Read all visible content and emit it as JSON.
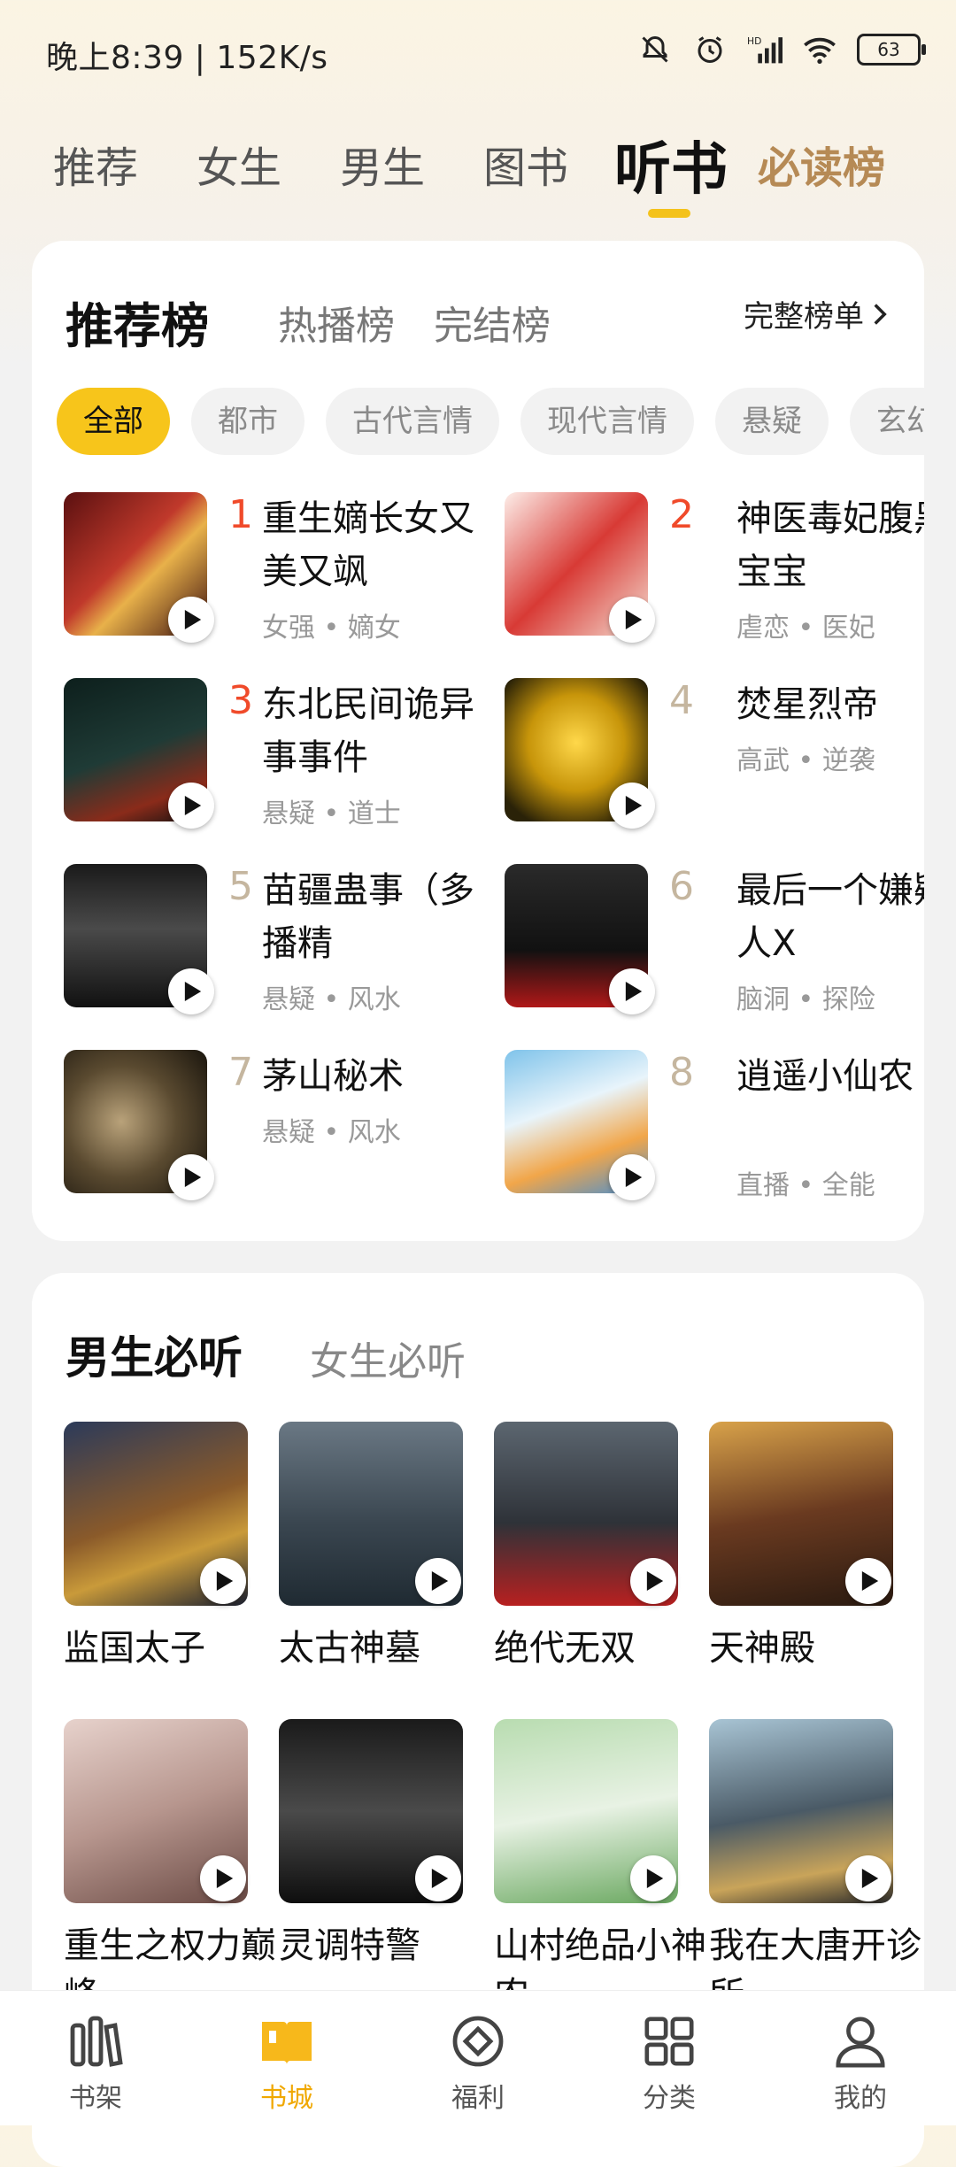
{
  "status_bar": {
    "time": "晚上8:39 | 152K/s",
    "battery": "63"
  },
  "top_tabs": [
    {
      "label": "推荐"
    },
    {
      "label": "女生"
    },
    {
      "label": "男生"
    },
    {
      "label": "图书"
    },
    {
      "label": "听书"
    },
    {
      "label": "必读榜"
    }
  ],
  "rank_card": {
    "tabs": [
      {
        "label": "推荐榜"
      },
      {
        "label": "热播榜"
      },
      {
        "label": "完结榜"
      }
    ],
    "full_list": "完整榜单",
    "chips": [
      {
        "label": "全部"
      },
      {
        "label": "都市"
      },
      {
        "label": "古代言情"
      },
      {
        "label": "现代言情"
      },
      {
        "label": "悬疑"
      },
      {
        "label": "玄幻"
      }
    ],
    "items": [
      {
        "rank": "1",
        "title": "重生嫡长女又美又飒",
        "tags": "女强 • 嫡女"
      },
      {
        "rank": "2",
        "title": "神医毒妃腹黑宝宝",
        "tags": "虐恋 • 医妃"
      },
      {
        "rank": "3",
        "title": "东北民间诡异事事件",
        "tags": "悬疑 • 道士"
      },
      {
        "rank": "4",
        "title": "焚星烈帝",
        "tags": "高武 • 逆袭"
      },
      {
        "rank": "5",
        "title": "苗疆蛊事（多播精",
        "tags": "悬疑 • 风水"
      },
      {
        "rank": "6",
        "title": "最后一个嫌疑人X",
        "tags": "脑洞 • 探险"
      },
      {
        "rank": "7",
        "title": "茅山秘术",
        "tags": "悬疑 • 风水"
      },
      {
        "rank": "8",
        "title": "逍遥小仙农",
        "tags": "直播 • 全能"
      }
    ]
  },
  "must_listen": {
    "tabs": [
      {
        "label": "男生必听"
      },
      {
        "label": "女生必听"
      }
    ],
    "items": [
      {
        "title": "监国太子"
      },
      {
        "title": "太古神墓"
      },
      {
        "title": "绝代无双"
      },
      {
        "title": "天神殿"
      },
      {
        "title": "重生之权力巅峰"
      },
      {
        "title": "灵调特警"
      },
      {
        "title": "山村绝品小神农"
      },
      {
        "title": "我在大唐开诊所"
      }
    ]
  },
  "bottom_nav": [
    {
      "label": "书架"
    },
    {
      "label": "书城"
    },
    {
      "label": "福利"
    },
    {
      "label": "分类"
    },
    {
      "label": "我的"
    }
  ]
}
